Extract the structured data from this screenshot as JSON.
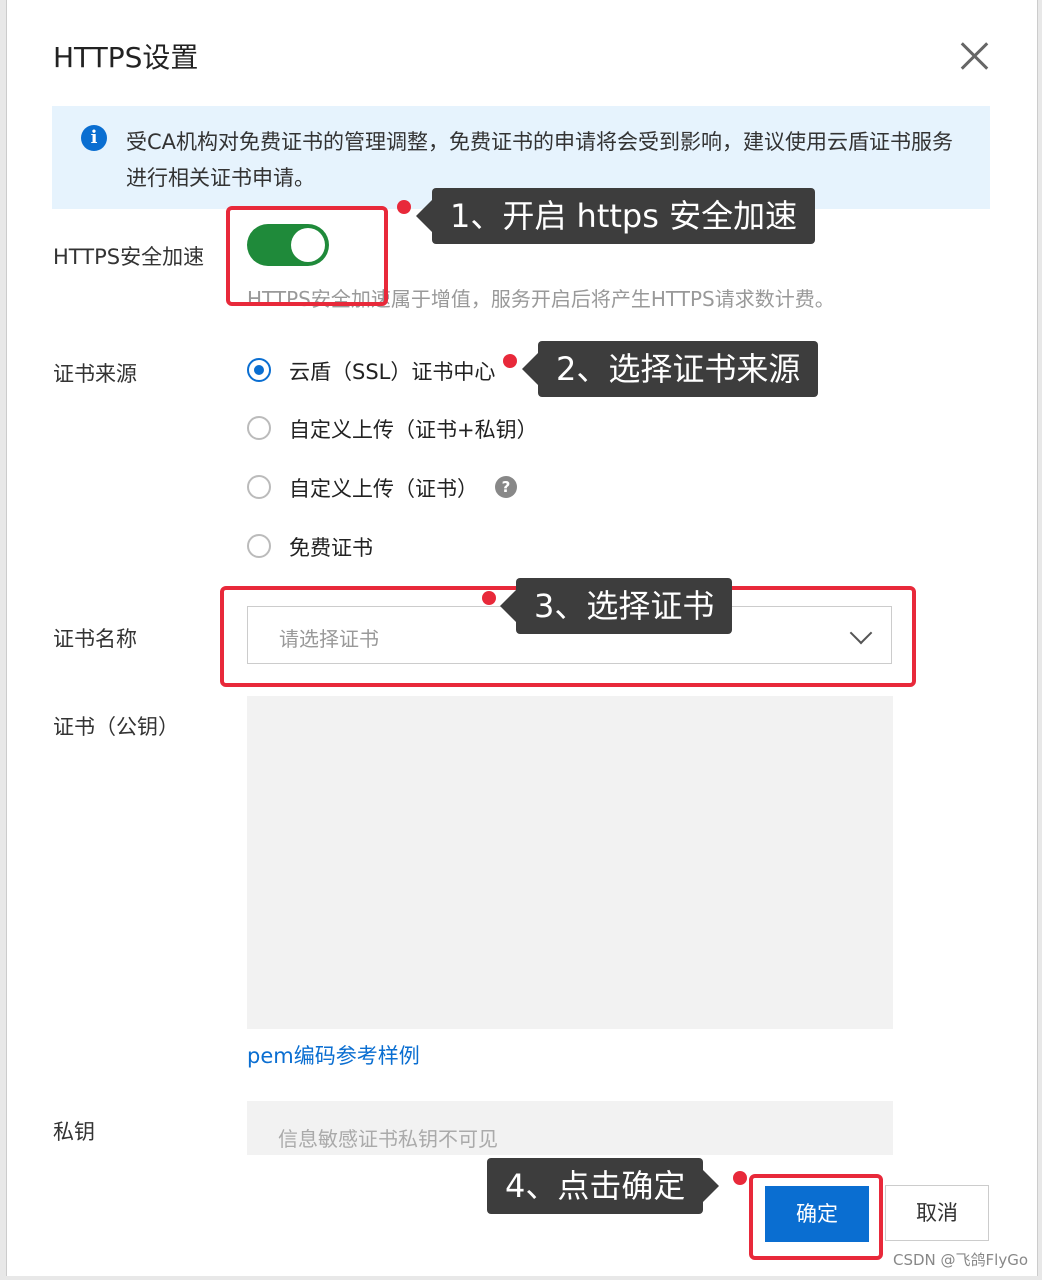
{
  "dialog": {
    "title": "HTTPS设置",
    "notice": "受CA机构对免费证书的管理调整，免费证书的申请将会受到影响，建议使用云盾证书服务进行相关证书申请。"
  },
  "https_acceleration": {
    "label": "HTTPS安全加速",
    "enabled": true,
    "help": "HTTPS安全加速属于增值，服务开启后将产生HTTPS请求数计费。"
  },
  "cert_source": {
    "label": "证书来源",
    "options": [
      {
        "label": "云盾（SSL）证书中心",
        "checked": true
      },
      {
        "label": "自定义上传（证书+私钥）",
        "checked": false
      },
      {
        "label": "自定义上传（证书）",
        "checked": false
      },
      {
        "label": "免费证书",
        "checked": false
      }
    ]
  },
  "cert_name": {
    "label": "证书名称",
    "placeholder": "请选择证书"
  },
  "cert_public": {
    "label": "证书（公钥）",
    "link": "pem编码参考样例"
  },
  "private_key": {
    "label": "私钥",
    "placeholder": "信息敏感证书私钥不可见"
  },
  "buttons": {
    "ok": "确定",
    "cancel": "取消"
  },
  "annotations": {
    "step1": "1、开启 https 安全加速",
    "step2": "2、选择证书来源",
    "step3": "3、选择证书",
    "step4": "4、点击确定"
  },
  "watermark": "CSDN @飞鸽FlyGo",
  "colors": {
    "primary": "#0a6ed1",
    "toggle_on": "#1f8a3a",
    "annotation_red": "#e8293a",
    "callout_bg": "#3d3d3d"
  }
}
